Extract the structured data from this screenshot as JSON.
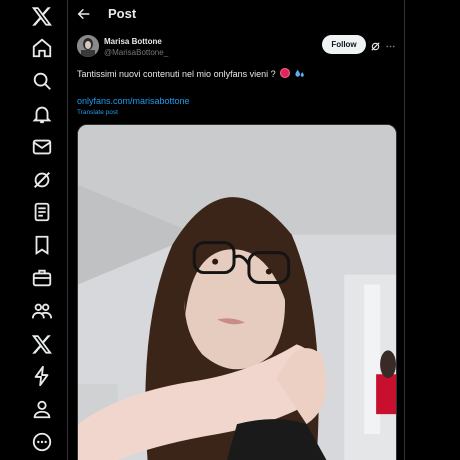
{
  "header": {
    "title": "Post"
  },
  "sidebar": {
    "items": [
      {
        "icon": "x-logo-icon"
      },
      {
        "icon": "home-icon"
      },
      {
        "icon": "search-icon"
      },
      {
        "icon": "notifications-icon"
      },
      {
        "icon": "messages-icon"
      },
      {
        "icon": "grok-icon"
      },
      {
        "icon": "lists-icon"
      },
      {
        "icon": "bookmarks-icon"
      },
      {
        "icon": "jobs-icon"
      },
      {
        "icon": "communities-icon"
      },
      {
        "icon": "premium-icon"
      },
      {
        "icon": "verified-orgs-icon"
      },
      {
        "icon": "profile-icon"
      },
      {
        "icon": "more-icon"
      }
    ]
  },
  "post": {
    "author_name": "Marisa Bottone",
    "author_handle": "@MarisaBottone_",
    "follow_label": "Follow",
    "text": "Tantissimi nuovi contenuti nel mio onlyfans vieni ?",
    "link": "onlyfans.com/marisabottone",
    "translate_label": "Translate post"
  },
  "colors": {
    "background": "#000000",
    "text": "#e7e9ea",
    "muted": "#71767b",
    "link": "#1d9bf0",
    "divider": "#2f3336",
    "follow_bg": "#eff3f4"
  }
}
